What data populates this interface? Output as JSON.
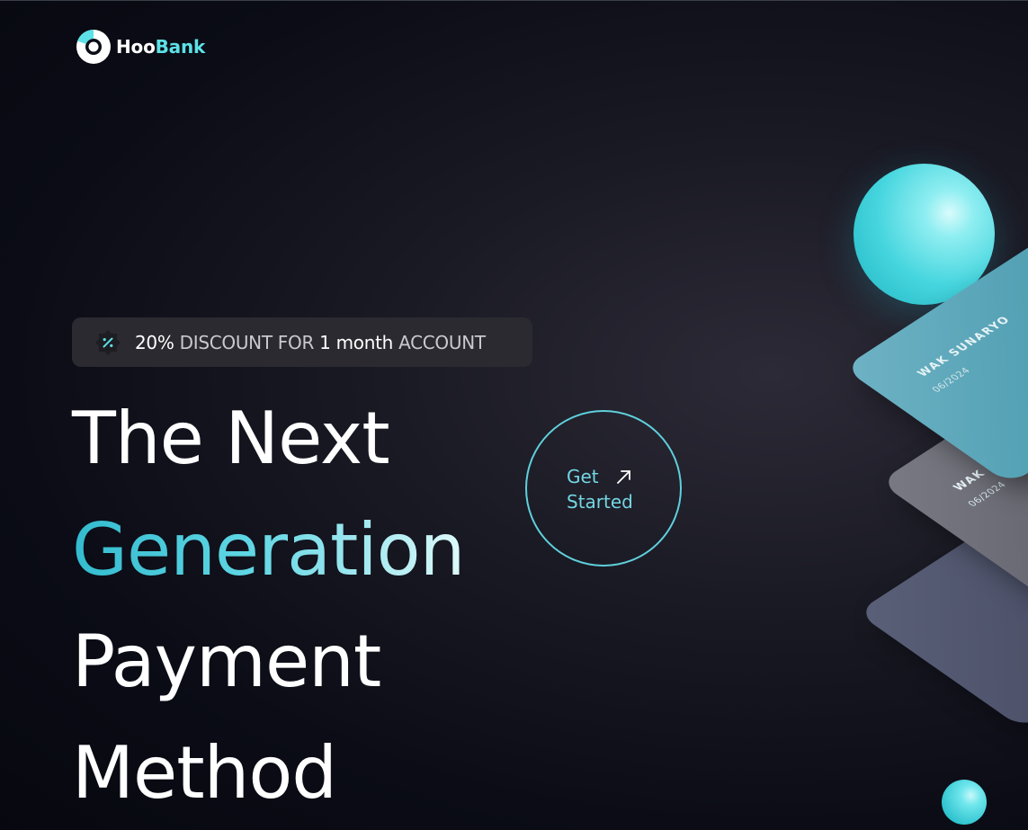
{
  "brand": {
    "name_part1": "Hoo",
    "name_part2": "Bank",
    "colors": {
      "accent": "#5ce1e6",
      "background": "#0b0c16",
      "pill": "#2a2a30",
      "text": "#ffffff"
    }
  },
  "discount": {
    "icon": "discount-icon",
    "amount": "20%",
    "label1": " DISCOUNT FOR ",
    "duration": "1 month",
    "label2": " ACCOUNT"
  },
  "hero": {
    "line1": "The Next",
    "line2": "Generation",
    "line3": "Payment",
    "line4": "Method"
  },
  "cta": {
    "line1": "Get",
    "line2": "Started",
    "icon": "arrow-up-right-icon"
  },
  "cards": [
    {
      "name": "WAK SUNARYO",
      "expiry": "06/2024"
    },
    {
      "name": "WAK SUNARYO",
      "expiry": "06/2024"
    },
    {
      "name": "",
      "expiry": ""
    }
  ]
}
